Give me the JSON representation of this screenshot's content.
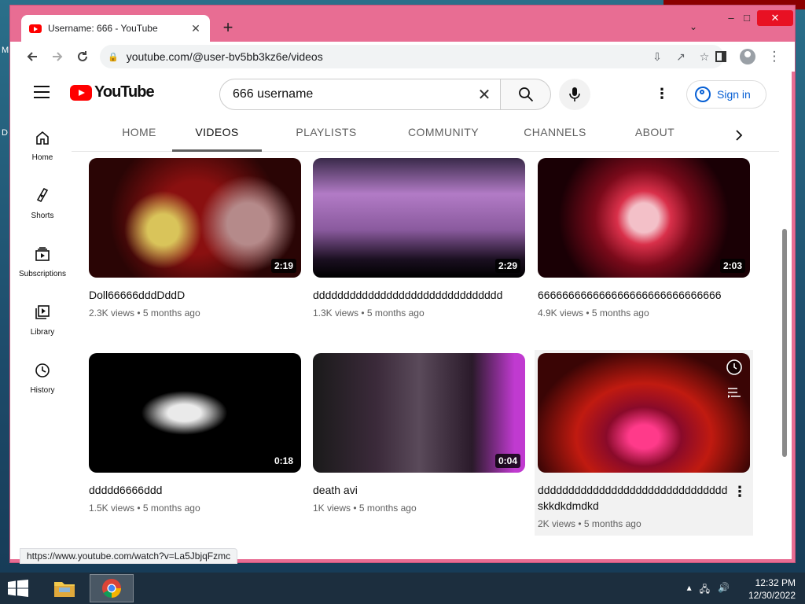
{
  "desktop": {
    "letters": [
      "M",
      "D"
    ]
  },
  "browser": {
    "tab_title": "Username: 666 - YouTube",
    "new_tab": "+",
    "url": "youtube.com/@user-bv5bb3kz6e/videos",
    "status_url": "https://www.youtube.com/watch?v=La5JbjqFzmc",
    "window_controls": {
      "minimize": "–",
      "maximize": "□",
      "close": "✕"
    }
  },
  "youtube": {
    "logo_text": "YouTube",
    "search_query": "666 username",
    "sign_in": "Sign in",
    "sidebar": [
      {
        "label": "Home",
        "icon": "home-icon"
      },
      {
        "label": "Shorts",
        "icon": "shorts-icon"
      },
      {
        "label": "Subscriptions",
        "icon": "subscriptions-icon"
      },
      {
        "label": "Library",
        "icon": "library-icon"
      },
      {
        "label": "History",
        "icon": "history-icon"
      }
    ],
    "channel_tabs": [
      "HOME",
      "VIDEOS",
      "PLAYLISTS",
      "COMMUNITY",
      "CHANNELS",
      "ABOUT"
    ],
    "active_tab": "VIDEOS",
    "videos": [
      {
        "title": "Doll66666dddDddD",
        "views": "2.3K views",
        "age": "5 months ago",
        "duration": "2:19"
      },
      {
        "title": "ddddddddddddddddddddddddddddddd",
        "views": "1.3K views",
        "age": "5 months ago",
        "duration": "2:29"
      },
      {
        "title": "666666666666666666666666666666",
        "views": "4.9K views",
        "age": "5 months ago",
        "duration": "2:03"
      },
      {
        "title": "ddddd6666ddd",
        "views": "1.5K views",
        "age": "5 months ago",
        "duration": "0:18"
      },
      {
        "title": "death avi",
        "views": "1K views",
        "age": "5 months ago",
        "duration": "0:04"
      },
      {
        "title": "dddddddddddddddddddddddddddddddskkdkdmdkd",
        "views": "2K views",
        "age": "5 months ago",
        "duration": ""
      }
    ],
    "meta_separator": "•"
  },
  "taskbar": {
    "time": "12:32 PM",
    "date": "12/30/2022"
  },
  "colors": {
    "brand": "#ff0000",
    "link": "#065fd4",
    "window_frame": "#e86d93"
  }
}
